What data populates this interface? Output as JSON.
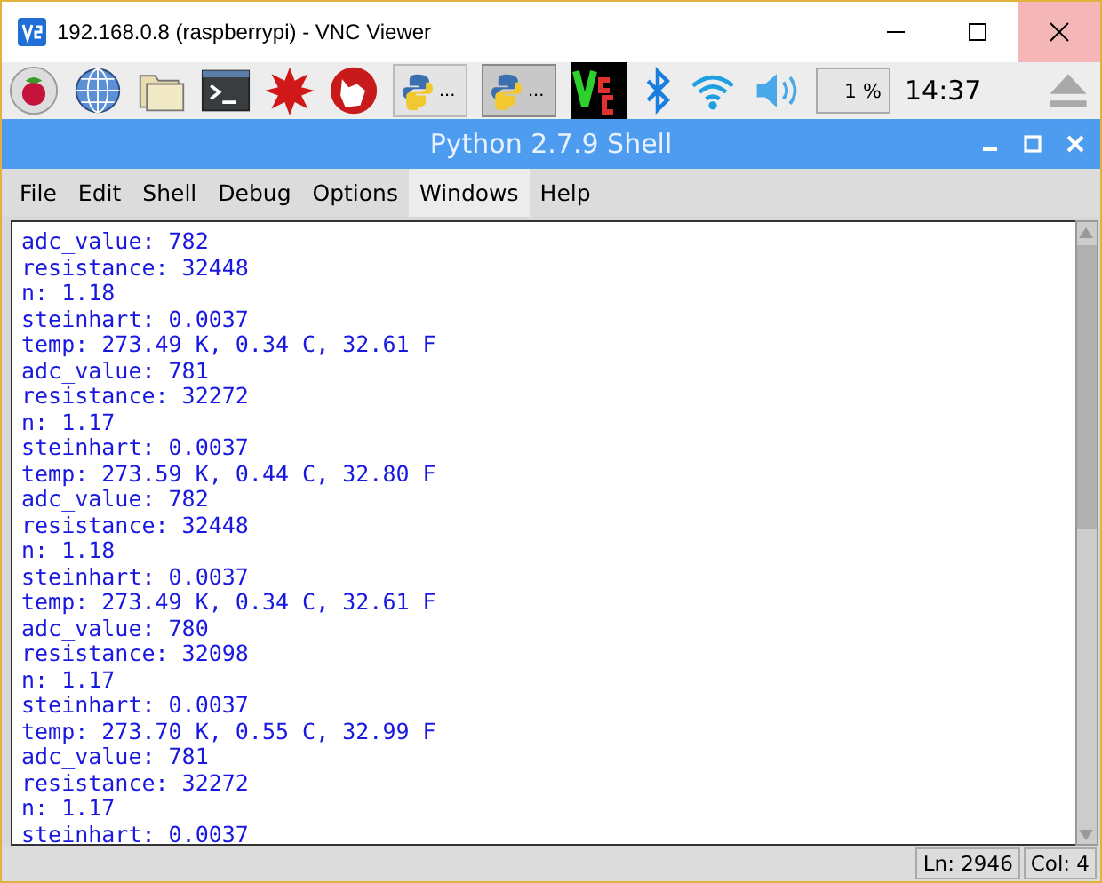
{
  "window": {
    "title": "192.168.0.8 (raspberrypi) - VNC Viewer"
  },
  "taskbar": {
    "launchers": [
      {
        "kind": "raspberry"
      },
      {
        "kind": "globe"
      },
      {
        "kind": "folder"
      },
      {
        "kind": "terminal"
      },
      {
        "kind": "burst"
      },
      {
        "kind": "wolf"
      }
    ],
    "tasks": [
      {
        "label": "...",
        "selected": false
      },
      {
        "label": "...",
        "selected": true
      }
    ],
    "tray": [
      {
        "kind": "vnc"
      },
      {
        "kind": "bluetooth"
      },
      {
        "kind": "wifi"
      },
      {
        "kind": "volume"
      }
    ],
    "cpu": "1 %",
    "clock": "14:37"
  },
  "shell": {
    "title": "Python 2.7.9 Shell"
  },
  "menu": [
    {
      "label": "File",
      "selected": false
    },
    {
      "label": "Edit",
      "selected": false
    },
    {
      "label": "Shell",
      "selected": false
    },
    {
      "label": "Debug",
      "selected": false
    },
    {
      "label": "Options",
      "selected": false
    },
    {
      "label": "Windows",
      "selected": true
    },
    {
      "label": "Help",
      "selected": false
    }
  ],
  "output": [
    "adc_value: 782",
    "resistance: 32448",
    "n: 1.18",
    "steinhart: 0.0037",
    "temp: 273.49 K, 0.34 C, 32.61 F",
    "adc_value: 781",
    "resistance: 32272",
    "n: 1.17",
    "steinhart: 0.0037",
    "temp: 273.59 K, 0.44 C, 32.80 F",
    "adc_value: 782",
    "resistance: 32448",
    "n: 1.18",
    "steinhart: 0.0037",
    "temp: 273.49 K, 0.34 C, 32.61 F",
    "adc_value: 780",
    "resistance: 32098",
    "n: 1.17",
    "steinhart: 0.0037",
    "temp: 273.70 K, 0.55 C, 32.99 F",
    "adc_value: 781",
    "resistance: 32272",
    "n: 1.17",
    "steinhart: 0.0037"
  ],
  "status_bar": {
    "line": "Ln: 2946",
    "column": "Col: 4"
  }
}
